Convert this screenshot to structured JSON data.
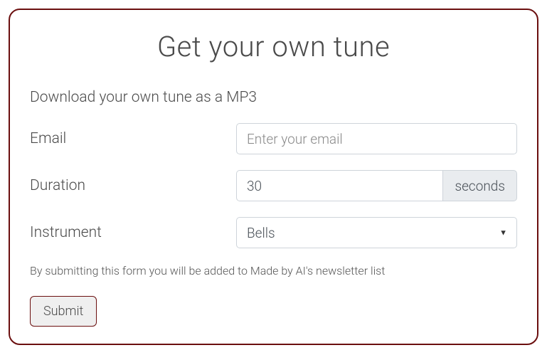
{
  "title": "Get your own tune",
  "subtitle": "Download your own tune as a MP3",
  "fields": {
    "email": {
      "label": "Email",
      "placeholder": "Enter your email",
      "value": ""
    },
    "duration": {
      "label": "Duration",
      "value": "30",
      "unit": "seconds"
    },
    "instrument": {
      "label": "Instrument",
      "selected": "Bells"
    }
  },
  "disclaimer": "By submitting this form you will be added to Made by AI's newsletter list",
  "submit_label": "Submit",
  "colors": {
    "border": "#6b0f0f",
    "addon_bg": "#e9ecef"
  }
}
